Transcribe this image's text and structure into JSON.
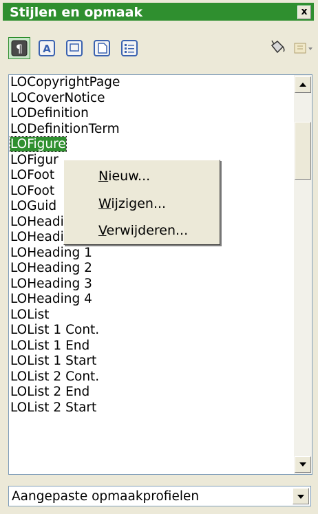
{
  "panel": {
    "title": "Stijlen en opmaak",
    "close_label": "x",
    "accent_color": "#2f8f2f"
  },
  "toolbar": {
    "buttons": [
      {
        "icon": "paragraph-styles-icon",
        "active": true
      },
      {
        "icon": "character-styles-icon",
        "active": false
      },
      {
        "icon": "frame-styles-icon",
        "active": false
      },
      {
        "icon": "page-styles-icon",
        "active": false
      },
      {
        "icon": "list-styles-icon",
        "active": false
      },
      {
        "icon": "fill-format-mode-icon",
        "active": false
      },
      {
        "icon": "new-style-from-selection-icon",
        "active": false
      }
    ]
  },
  "styles_list": {
    "items": [
      "LOCopyrightPage",
      "LOCoverNotice",
      "LODefinition",
      "LODefinitionTerm",
      "LOFigure",
      "LOFigur",
      "LOFoot",
      "LOFoot",
      "LOGuid",
      "LOHeading",
      "LOHeading 0",
      "LOHeading 1",
      "LOHeading 2",
      "LOHeading 3",
      "LOHeading 4",
      "LOList",
      "LOList 1 Cont.",
      "LOList 1 End",
      "LOList 1 Start",
      "LOList 2 Cont.",
      "LOList 2 End",
      "LOList 2 Start"
    ],
    "selected": "LOFigure"
  },
  "context_menu": {
    "items": [
      {
        "accel": "N",
        "rest": "ieuw..."
      },
      {
        "accel": "W",
        "rest": "ijzigen..."
      },
      {
        "accel": "V",
        "rest": "erwijderen..."
      }
    ]
  },
  "filter": {
    "value": "Aangepaste opmaakprofielen"
  }
}
